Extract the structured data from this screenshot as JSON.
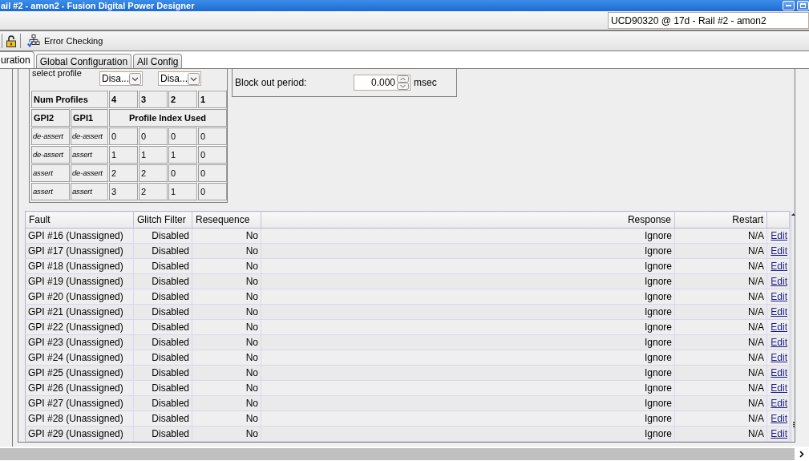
{
  "window": {
    "title": "ail #2 - amon2 - Fusion Digital Power Designer"
  },
  "device_selector": {
    "value": "UCD90320 @ 17d - Rail #2 - amon2"
  },
  "toolbar": {
    "error_checking": "Error Checking"
  },
  "tabs": [
    {
      "label": "uration",
      "selected": true
    },
    {
      "label": "Global Configuration",
      "selected": false
    },
    {
      "label": "All Config",
      "selected": false
    }
  ],
  "profile": {
    "select_label": "select profile",
    "selects": [
      "Disa...",
      "Disa..."
    ],
    "num_profiles_label": "Num Profiles",
    "num_profiles": [
      "4",
      "3",
      "2",
      "1"
    ],
    "gpi2_header": "GPI2",
    "gpi1_header": "GPI1",
    "index_header": "Profile Index Used",
    "rows": [
      {
        "gpi2": "de-assert",
        "gpi1": "de-assert",
        "indexes": [
          "0",
          "0",
          "0",
          "0"
        ]
      },
      {
        "gpi2": "de-assert",
        "gpi1": "assert",
        "indexes": [
          "1",
          "1",
          "1",
          "0"
        ]
      },
      {
        "gpi2": "assert",
        "gpi1": "de-assert",
        "indexes": [
          "2",
          "2",
          "0",
          "0"
        ]
      },
      {
        "gpi2": "assert",
        "gpi1": "assert",
        "indexes": [
          "3",
          "2",
          "1",
          "0"
        ]
      }
    ]
  },
  "block_out": {
    "label": "Block out period:",
    "value": "0.000",
    "unit": "msec"
  },
  "faults": {
    "columns": [
      "Fault",
      "Glitch Filter",
      "Resequence",
      "Response",
      "Restart"
    ],
    "rows": [
      {
        "cells": [
          "GPI #16 (Unassigned)",
          "Disabled",
          "No",
          "Ignore",
          "N/A"
        ],
        "action": "Edit"
      },
      {
        "cells": [
          "GPI #17 (Unassigned)",
          "Disabled",
          "No",
          "Ignore",
          "N/A"
        ],
        "action": "Edit"
      },
      {
        "cells": [
          "GPI #18 (Unassigned)",
          "Disabled",
          "No",
          "Ignore",
          "N/A"
        ],
        "action": "Edit"
      },
      {
        "cells": [
          "GPI #19 (Unassigned)",
          "Disabled",
          "No",
          "Ignore",
          "N/A"
        ],
        "action": "Edit"
      },
      {
        "cells": [
          "GPI #20 (Unassigned)",
          "Disabled",
          "No",
          "Ignore",
          "N/A"
        ],
        "action": "Edit"
      },
      {
        "cells": [
          "GPI #21 (Unassigned)",
          "Disabled",
          "No",
          "Ignore",
          "N/A"
        ],
        "action": "Edit"
      },
      {
        "cells": [
          "GPI #22 (Unassigned)",
          "Disabled",
          "No",
          "Ignore",
          "N/A"
        ],
        "action": "Edit"
      },
      {
        "cells": [
          "GPI #23 (Unassigned)",
          "Disabled",
          "No",
          "Ignore",
          "N/A"
        ],
        "action": "Edit"
      },
      {
        "cells": [
          "GPI #24 (Unassigned)",
          "Disabled",
          "No",
          "Ignore",
          "N/A"
        ],
        "action": "Edit"
      },
      {
        "cells": [
          "GPI #25 (Unassigned)",
          "Disabled",
          "No",
          "Ignore",
          "N/A"
        ],
        "action": "Edit"
      },
      {
        "cells": [
          "GPI #26 (Unassigned)",
          "Disabled",
          "No",
          "Ignore",
          "N/A"
        ],
        "action": "Edit"
      },
      {
        "cells": [
          "GPI #27 (Unassigned)",
          "Disabled",
          "No",
          "Ignore",
          "N/A"
        ],
        "action": "Edit"
      },
      {
        "cells": [
          "GPI #28 (Unassigned)",
          "Disabled",
          "No",
          "Ignore",
          "N/A"
        ],
        "action": "Edit"
      },
      {
        "cells": [
          "GPI #29 (Unassigned)",
          "Disabled",
          "No",
          "Ignore",
          "N/A"
        ],
        "action": "Edit"
      }
    ]
  }
}
